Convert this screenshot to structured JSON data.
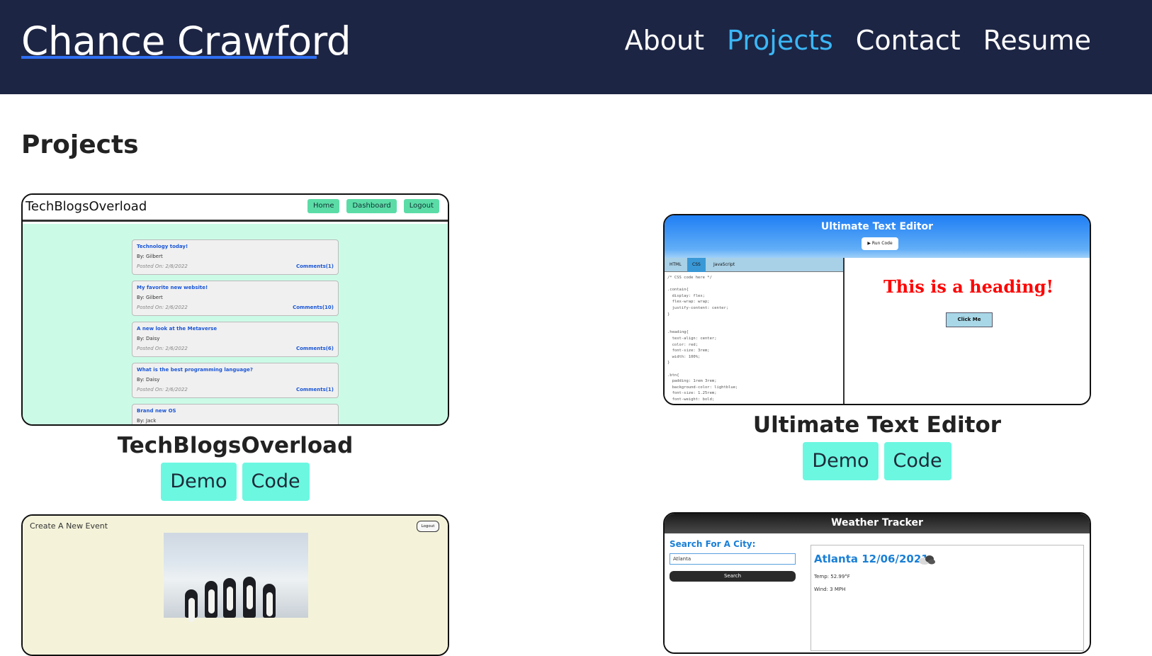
{
  "header": {
    "brand": "Chance Crawford",
    "nav": [
      {
        "label": "About"
      },
      {
        "label": "Projects"
      },
      {
        "label": "Contact"
      },
      {
        "label": "Resume"
      }
    ]
  },
  "page_title": "Projects",
  "projects": [
    {
      "title": "TechBlogsOverload",
      "demo_label": "Demo",
      "code_label": "Code",
      "screenshot": {
        "brand": "TechBlogsOverload",
        "nav": [
          "Home",
          "Dashboard",
          "Logout"
        ],
        "posts": [
          {
            "title": "Technology today!",
            "author": "By: Gilbert",
            "date": "Posted On: 2/8/2022",
            "comments": "Comments(1)"
          },
          {
            "title": "My favorite new website!",
            "author": "By: Gilbert",
            "date": "Posted On: 2/6/2022",
            "comments": "Comments(10)"
          },
          {
            "title": "A new look at the Metaverse",
            "author": "By: Daisy",
            "date": "Posted On: 2/6/2022",
            "comments": "Comments(6)"
          },
          {
            "title": "What is the best programming language?",
            "author": "By: Daisy",
            "date": "Posted On: 2/6/2022",
            "comments": "Comments(1)"
          },
          {
            "title": "Brand new OS",
            "author": "By: Jack",
            "date": "",
            "comments": ""
          }
        ]
      }
    },
    {
      "title": "Ultimate Text Editor",
      "demo_label": "Demo",
      "code_label": "Code",
      "screenshot": {
        "title": "Ultimate Text Editor",
        "run_button": "▶ Run Code",
        "tabs": [
          "HTML",
          "CSS",
          "JavaScript"
        ],
        "active_tab": "CSS",
        "code": "/* CSS code here */\n\n.contain{\n  display: flex;\n  flex-wrap: wrap;\n  justify-content: center;\n}\n\n\n.heading{\n  text-align: center;\n  color: red;\n  font-size: 3rem;\n  width: 100%;\n}\n\n.btn{\n  padding: 1rem 3rem;\n  background-color: lightblue;\n  font-size: 1.25rem;\n  font-weight: bold;\n}",
        "preview_heading": "This is a heading!",
        "preview_button": "Click Me"
      }
    },
    {
      "title": "",
      "screenshot": {
        "title": "Create A New Event",
        "logout": "Logout"
      }
    },
    {
      "title": "",
      "screenshot": {
        "title": "Weather Tracker",
        "search_label": "Search For A City:",
        "input_value": "Atlanta",
        "search_button": "Search",
        "city_date": "Atlanta 12/06/2021",
        "temp": "Temp: 52.99°F",
        "wind": "Wind: 3 MPH"
      }
    }
  ],
  "colors": {
    "header_bg": "#1d2544",
    "nav_active": "#3bb7f6",
    "brand_underline": "#2e6ff2",
    "action_button": "#6cf7e1"
  }
}
